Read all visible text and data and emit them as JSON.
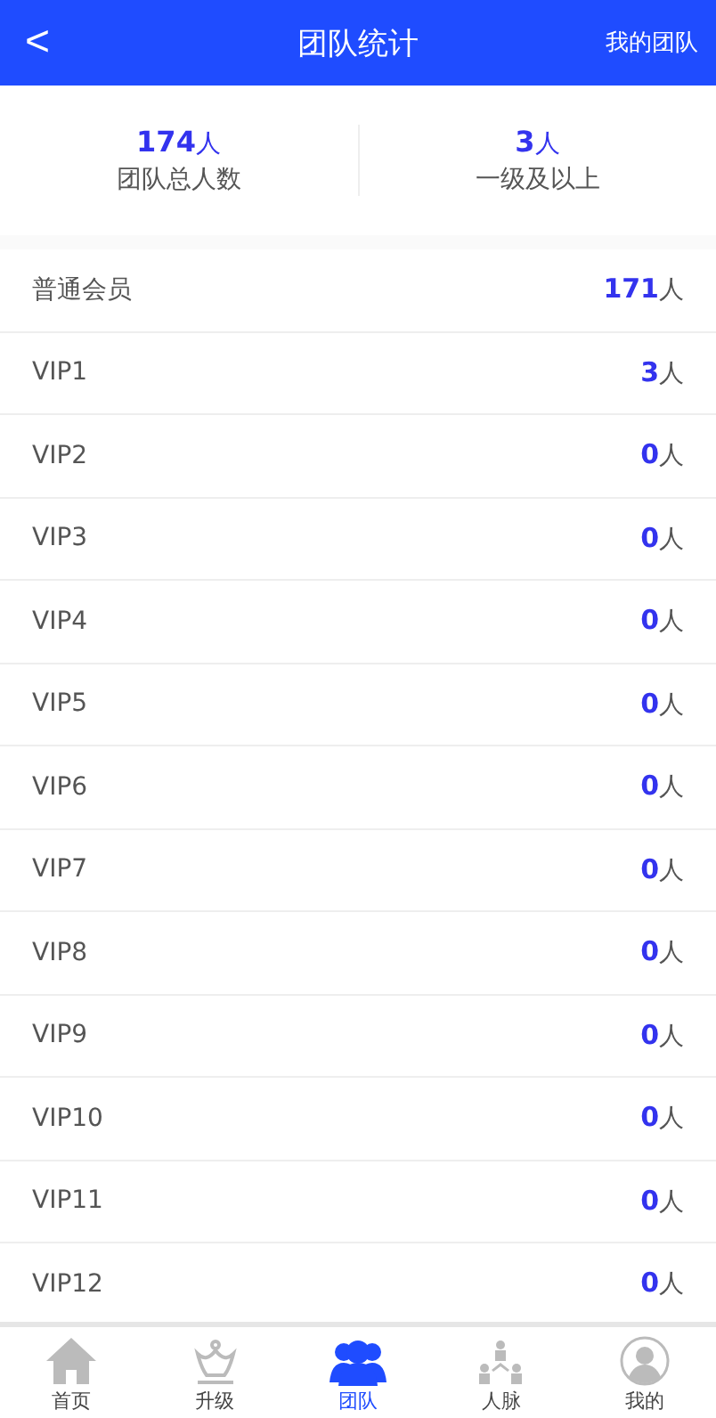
{
  "header": {
    "back": "<",
    "title": "团队统计",
    "action": "我的团队"
  },
  "stats": [
    {
      "count": "174",
      "unit": "人",
      "label": "团队总人数"
    },
    {
      "count": "3",
      "unit": "人",
      "label": "一级及以上"
    }
  ],
  "levels": [
    {
      "name": "普通会员",
      "count": "171",
      "unit": "人"
    },
    {
      "name": "VIP1",
      "count": "3",
      "unit": "人"
    },
    {
      "name": "VIP2",
      "count": "0",
      "unit": "人"
    },
    {
      "name": "VIP3",
      "count": "0",
      "unit": "人"
    },
    {
      "name": "VIP4",
      "count": "0",
      "unit": "人"
    },
    {
      "name": "VIP5",
      "count": "0",
      "unit": "人"
    },
    {
      "name": "VIP6",
      "count": "0",
      "unit": "人"
    },
    {
      "name": "VIP7",
      "count": "0",
      "unit": "人"
    },
    {
      "name": "VIP8",
      "count": "0",
      "unit": "人"
    },
    {
      "name": "VIP9",
      "count": "0",
      "unit": "人"
    },
    {
      "name": "VIP10",
      "count": "0",
      "unit": "人"
    },
    {
      "name": "VIP11",
      "count": "0",
      "unit": "人"
    },
    {
      "name": "VIP12",
      "count": "0",
      "unit": "人"
    }
  ],
  "nav": [
    {
      "kind": "home",
      "label": "首页",
      "selected": false
    },
    {
      "kind": "crown",
      "label": "升级",
      "selected": false
    },
    {
      "kind": "team",
      "label": "团队",
      "selected": true
    },
    {
      "kind": "network",
      "label": "人脉",
      "selected": false
    },
    {
      "kind": "user",
      "label": "我的",
      "selected": false
    }
  ]
}
